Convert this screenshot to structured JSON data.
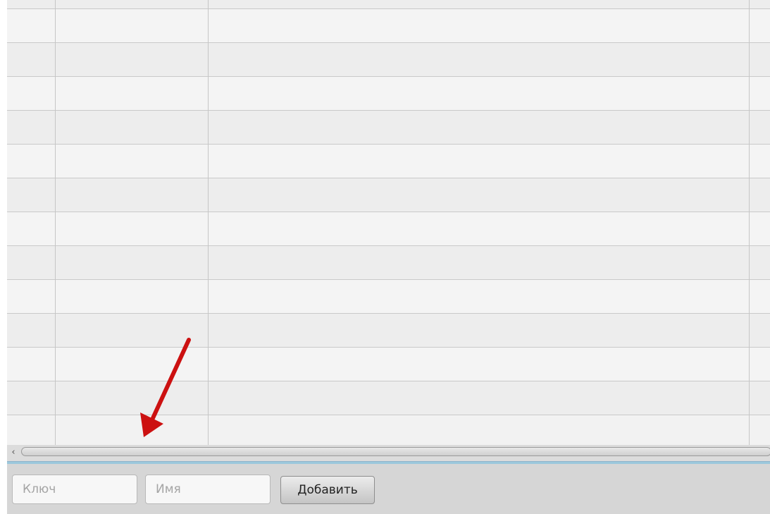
{
  "table": {
    "row_count": 13,
    "column_count": 3
  },
  "scrollbar": {
    "left_arrow_glyph": "‹",
    "left_arrow_icon": "chevron-left-icon"
  },
  "form": {
    "key_placeholder": "Ключ",
    "key_value": "",
    "name_placeholder": "Имя",
    "name_value": "",
    "add_label": "Добавить"
  },
  "annotation": {
    "icon": "arrow-down-left-icon",
    "color": "#cc1111"
  },
  "colors": {
    "accent": "#9cc8dc",
    "table_background": "#f2f2f2",
    "toolbar_background": "#d6d6d6"
  }
}
